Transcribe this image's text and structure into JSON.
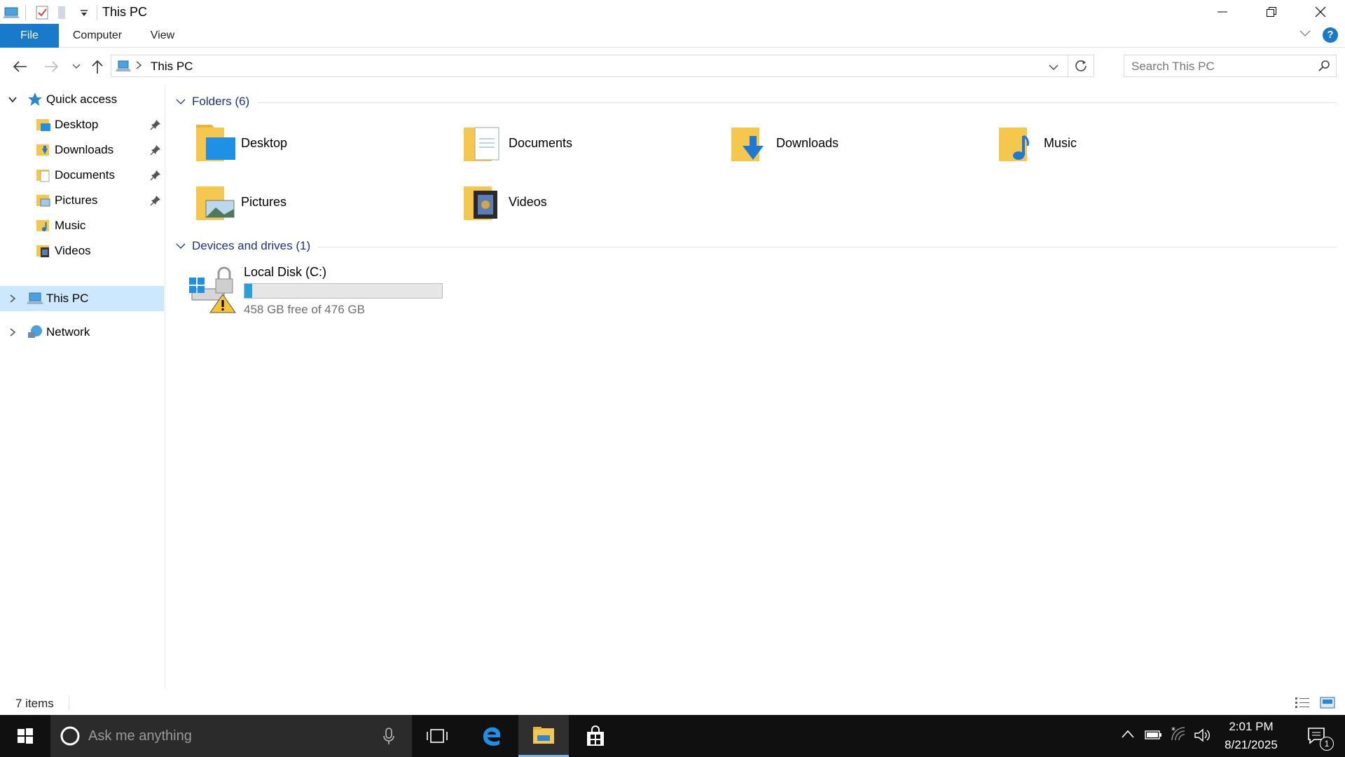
{
  "window": {
    "title": "This PC"
  },
  "ribbon": {
    "tabs": [
      "File",
      "Computer",
      "View"
    ],
    "help_label": "?"
  },
  "address": {
    "path": "This PC",
    "search_placeholder": "Search This PC"
  },
  "sidebar": {
    "quick_access": "Quick access",
    "quick_items": [
      "Desktop",
      "Downloads",
      "Documents",
      "Pictures",
      "Music",
      "Videos"
    ],
    "this_pc": "This PC",
    "network": "Network"
  },
  "content": {
    "folders_header": "Folders (6)",
    "folders": [
      "Desktop",
      "Documents",
      "Downloads",
      "Music",
      "Pictures",
      "Videos"
    ],
    "drives_header": "Devices and drives (1)",
    "drive": {
      "name": "Local Disk (C:)",
      "free_text": "458 GB free of 476 GB",
      "used_fraction": 0.038
    }
  },
  "status": {
    "items": "7 items"
  },
  "taskbar": {
    "search_placeholder": "Ask me anything",
    "time": "2:01 PM",
    "date": "8/21/2025",
    "notification_count": "1"
  },
  "colors": {
    "accent": "#1979ca",
    "selected": "#cce8ff",
    "folder": "#f5c74d",
    "drive_fill": "#26a0da",
    "taskbar": "#101010"
  }
}
